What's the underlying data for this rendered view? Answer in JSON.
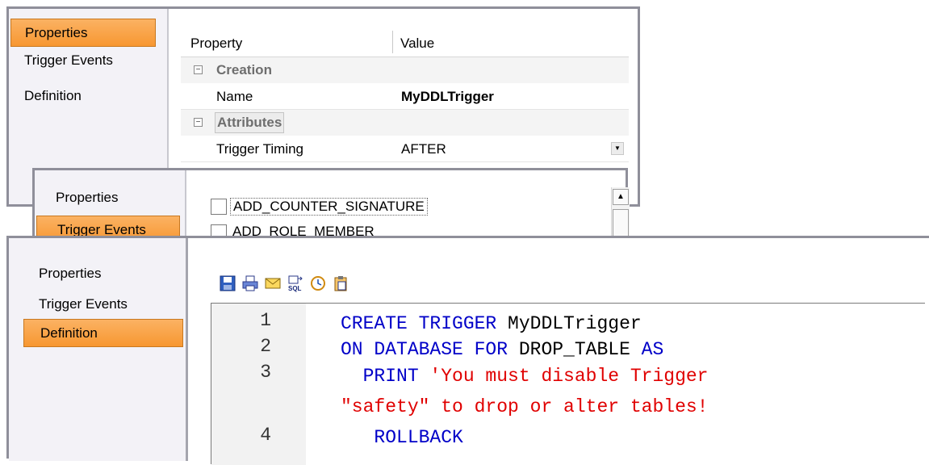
{
  "panel_properties": {
    "nav": {
      "properties": "Properties",
      "trigger_events": "Trigger Events",
      "definition": "Definition"
    },
    "grid": {
      "col_property": "Property",
      "col_value": "Value",
      "group_creation": "Creation",
      "name_key": "Name",
      "name_value": "MyDDLTrigger",
      "group_attributes": "Attributes",
      "timing_key": "Trigger Timing",
      "timing_value": "AFTER"
    }
  },
  "panel_events": {
    "nav": {
      "properties": "Properties",
      "trigger_events": "Trigger Events"
    },
    "events": [
      "ADD_COUNTER_SIGNATURE",
      "ADD_ROLE_MEMBER"
    ]
  },
  "panel_definition": {
    "nav": {
      "properties": "Properties",
      "trigger_events": "Trigger Events",
      "definition": "Definition"
    },
    "toolbar_icons": [
      "save-icon",
      "print-icon",
      "email-icon",
      "sql-export-icon",
      "schedule-icon",
      "paste-icon"
    ],
    "code": {
      "line_numbers": [
        "1",
        "2",
        "3",
        "4"
      ],
      "l1_kw": "CREATE TRIGGER ",
      "l1_id": "MyDDLTrigger",
      "l2_kw1": "ON DATABASE FOR ",
      "l2_id": "DROP_TABLE",
      "l2_kw2": " AS",
      "l3_kw": "  PRINT ",
      "l3_str": "'You must disable Trigger",
      "l3b_str": "\"safety\" to drop or alter tables!",
      "l4_kw": "   ROLLBACK"
    }
  },
  "colors": {
    "selected_tab": "#f79731",
    "keyword": "#0000c8",
    "string": "#e00000"
  }
}
